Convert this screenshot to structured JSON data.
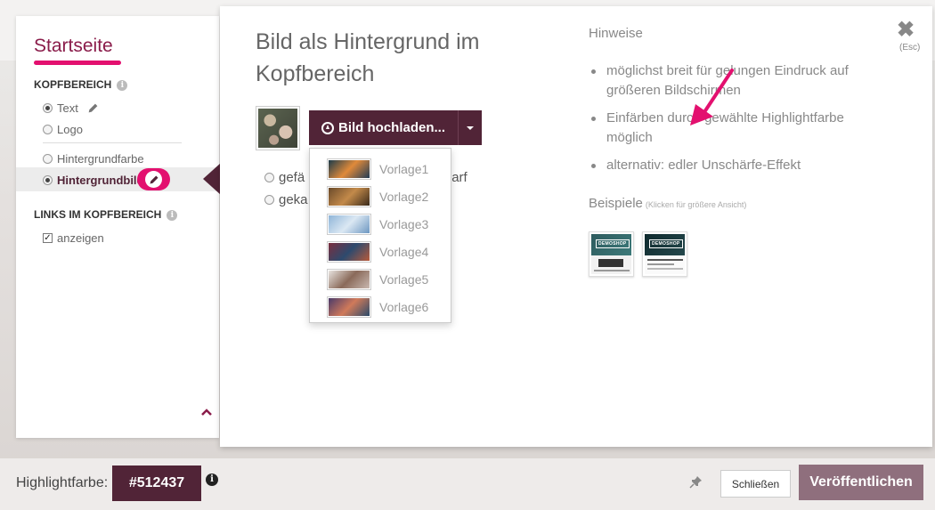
{
  "sidebar": {
    "title": "Startseite",
    "section_kopf": "KOPFBEREICH",
    "opt_text": "Text",
    "opt_logo": "Logo",
    "opt_hintergrundfarbe": "Hintergrundfarbe",
    "opt_hintergrundbild": "Hintergrundbild",
    "section_links": "LINKS IM KOPFBEREICH",
    "links_checkbox": "anzeigen",
    "info_glyph": "i"
  },
  "modal": {
    "title": "Bild als Hintergrund im Kopfbereich",
    "upload_label": "Bild hochladen...",
    "radio1": "gefä",
    "radio1_tail": "arf",
    "radio2": "geka",
    "dropdown": [
      {
        "label": "Vorlage1",
        "colors": [
          "#1d3b4a",
          "#e08a3a",
          "#213c56"
        ]
      },
      {
        "label": "Vorlage2",
        "colors": [
          "#6a4a2a",
          "#c38a4a",
          "#3a2a1a"
        ]
      },
      {
        "label": "Vorlage3",
        "colors": [
          "#8fb5d8",
          "#dbe8f3",
          "#6d97c1"
        ]
      },
      {
        "label": "Vorlage4",
        "colors": [
          "#7a2e3e",
          "#2d4a6e",
          "#b85a3a"
        ]
      },
      {
        "label": "Vorlage5",
        "colors": [
          "#e8e4e0",
          "#8a6a5a",
          "#c9b8b0"
        ]
      },
      {
        "label": "Vorlage6",
        "colors": [
          "#4a3a6a",
          "#d07a5a",
          "#2a4a6a"
        ]
      }
    ],
    "hint_title": "Hinweise",
    "hints": [
      "möglichst breit für gelungen Eindruck auf größeren Bildschirmen",
      "Einfärben durch gewählte Highlightfarbe möglich",
      "alternativ: edler Unschärfe-Effekt"
    ],
    "examples_title": "Beispiele",
    "examples_note": "(Klicken für größere Ansicht)",
    "example_labels": [
      "DEMOSHOP",
      "DEMOSHOP"
    ],
    "close_glyph": "✖",
    "close_hint": "(Esc)"
  },
  "bottom": {
    "highlight_label": "Highlightfarbe:",
    "highlight_value": "#512437",
    "close_label": "Schließen",
    "publish_label": "Veröffentlichen"
  },
  "colors": {
    "accent": "#512437",
    "annotation_pink": "#e3106f",
    "sidebar_title": "#8a1c4a"
  },
  "icons": [
    "info-icon",
    "pencil-icon",
    "upload-icon",
    "caret-down-icon",
    "close-icon",
    "pin-icon",
    "chevron-up-icon",
    "annotation-arrow"
  ]
}
